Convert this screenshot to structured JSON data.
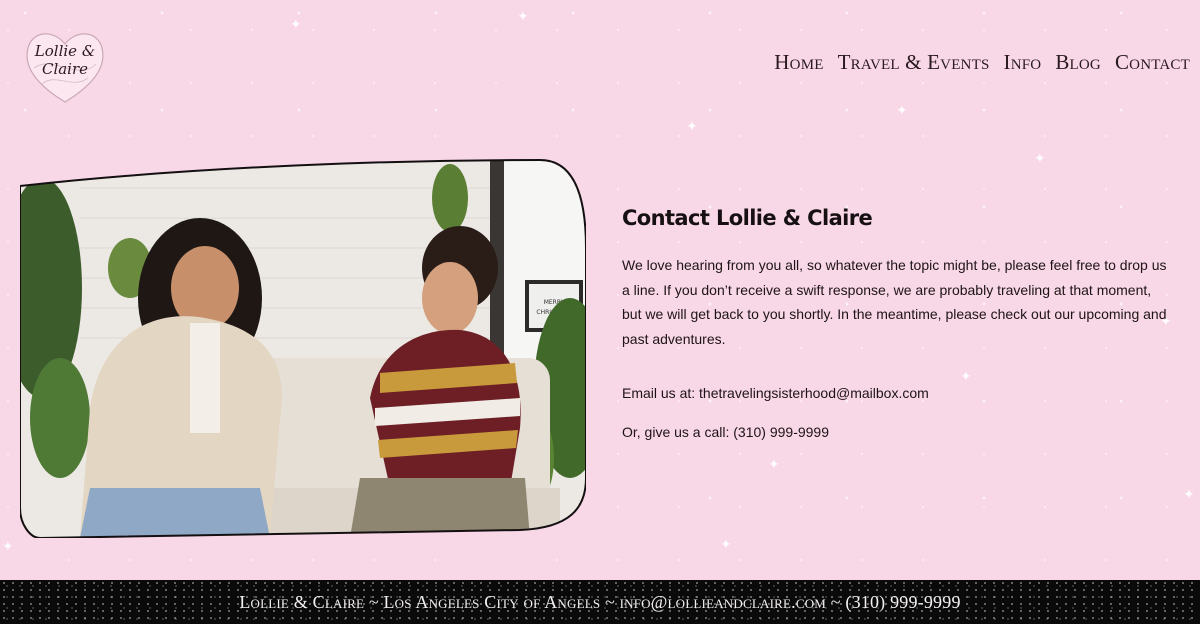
{
  "logo": {
    "text_line1": "Lollie &",
    "text_line2": "Claire"
  },
  "nav": {
    "items": [
      {
        "label": "Home"
      },
      {
        "label": "Travel & Events"
      },
      {
        "label": "Info"
      },
      {
        "label": "Blog"
      },
      {
        "label": "Contact"
      }
    ]
  },
  "photo": {
    "sign_text_line1": "MERRY",
    "sign_text_line2": "CHRISTMAS"
  },
  "contact": {
    "title": "Contact Lollie & Claire",
    "intro": "We love hearing from you all, so whatever the topic might be, please feel free to drop us a line. If you don’t receive a swift response, we are probably traveling at that moment, but we will get back to you shortly. In the meantime, please check out our upcoming and past adventures.",
    "email_line": "Email us at: thetravelingsisterhood@mailbox.com",
    "phone_line": "Or, give us a call: (310) 999-9999"
  },
  "footer": {
    "text": "Lollie & Claire ~ Los Angeles City of Angels ~ info@lollieandclaire.com ~ (310) 999-9999"
  },
  "colors": {
    "background": "#f8d7e6",
    "footer_bg": "#0a0a0a",
    "text": "#1e1416"
  }
}
